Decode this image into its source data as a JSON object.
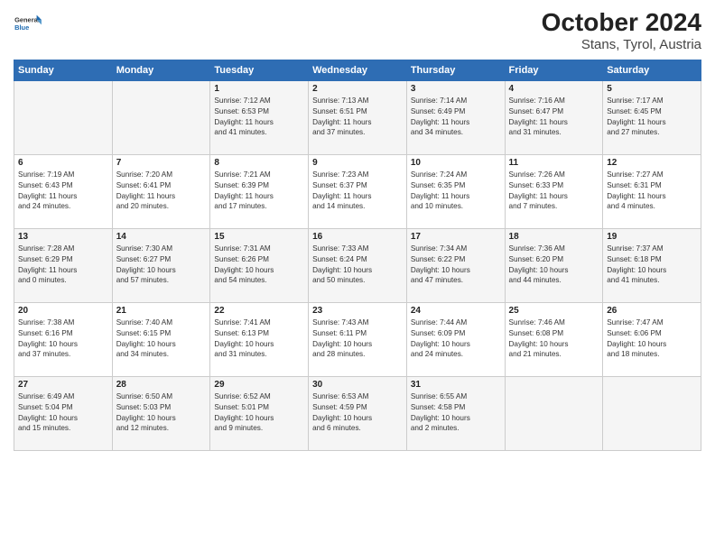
{
  "header": {
    "logo_general": "General",
    "logo_blue": "Blue",
    "month_title": "October 2024",
    "location": "Stans, Tyrol, Austria"
  },
  "weekdays": [
    "Sunday",
    "Monday",
    "Tuesday",
    "Wednesday",
    "Thursday",
    "Friday",
    "Saturday"
  ],
  "weeks": [
    [
      {
        "day": "",
        "info": ""
      },
      {
        "day": "",
        "info": ""
      },
      {
        "day": "1",
        "info": "Sunrise: 7:12 AM\nSunset: 6:53 PM\nDaylight: 11 hours\nand 41 minutes."
      },
      {
        "day": "2",
        "info": "Sunrise: 7:13 AM\nSunset: 6:51 PM\nDaylight: 11 hours\nand 37 minutes."
      },
      {
        "day": "3",
        "info": "Sunrise: 7:14 AM\nSunset: 6:49 PM\nDaylight: 11 hours\nand 34 minutes."
      },
      {
        "day": "4",
        "info": "Sunrise: 7:16 AM\nSunset: 6:47 PM\nDaylight: 11 hours\nand 31 minutes."
      },
      {
        "day": "5",
        "info": "Sunrise: 7:17 AM\nSunset: 6:45 PM\nDaylight: 11 hours\nand 27 minutes."
      }
    ],
    [
      {
        "day": "6",
        "info": "Sunrise: 7:19 AM\nSunset: 6:43 PM\nDaylight: 11 hours\nand 24 minutes."
      },
      {
        "day": "7",
        "info": "Sunrise: 7:20 AM\nSunset: 6:41 PM\nDaylight: 11 hours\nand 20 minutes."
      },
      {
        "day": "8",
        "info": "Sunrise: 7:21 AM\nSunset: 6:39 PM\nDaylight: 11 hours\nand 17 minutes."
      },
      {
        "day": "9",
        "info": "Sunrise: 7:23 AM\nSunset: 6:37 PM\nDaylight: 11 hours\nand 14 minutes."
      },
      {
        "day": "10",
        "info": "Sunrise: 7:24 AM\nSunset: 6:35 PM\nDaylight: 11 hours\nand 10 minutes."
      },
      {
        "day": "11",
        "info": "Sunrise: 7:26 AM\nSunset: 6:33 PM\nDaylight: 11 hours\nand 7 minutes."
      },
      {
        "day": "12",
        "info": "Sunrise: 7:27 AM\nSunset: 6:31 PM\nDaylight: 11 hours\nand 4 minutes."
      }
    ],
    [
      {
        "day": "13",
        "info": "Sunrise: 7:28 AM\nSunset: 6:29 PM\nDaylight: 11 hours\nand 0 minutes."
      },
      {
        "day": "14",
        "info": "Sunrise: 7:30 AM\nSunset: 6:27 PM\nDaylight: 10 hours\nand 57 minutes."
      },
      {
        "day": "15",
        "info": "Sunrise: 7:31 AM\nSunset: 6:26 PM\nDaylight: 10 hours\nand 54 minutes."
      },
      {
        "day": "16",
        "info": "Sunrise: 7:33 AM\nSunset: 6:24 PM\nDaylight: 10 hours\nand 50 minutes."
      },
      {
        "day": "17",
        "info": "Sunrise: 7:34 AM\nSunset: 6:22 PM\nDaylight: 10 hours\nand 47 minutes."
      },
      {
        "day": "18",
        "info": "Sunrise: 7:36 AM\nSunset: 6:20 PM\nDaylight: 10 hours\nand 44 minutes."
      },
      {
        "day": "19",
        "info": "Sunrise: 7:37 AM\nSunset: 6:18 PM\nDaylight: 10 hours\nand 41 minutes."
      }
    ],
    [
      {
        "day": "20",
        "info": "Sunrise: 7:38 AM\nSunset: 6:16 PM\nDaylight: 10 hours\nand 37 minutes."
      },
      {
        "day": "21",
        "info": "Sunrise: 7:40 AM\nSunset: 6:15 PM\nDaylight: 10 hours\nand 34 minutes."
      },
      {
        "day": "22",
        "info": "Sunrise: 7:41 AM\nSunset: 6:13 PM\nDaylight: 10 hours\nand 31 minutes."
      },
      {
        "day": "23",
        "info": "Sunrise: 7:43 AM\nSunset: 6:11 PM\nDaylight: 10 hours\nand 28 minutes."
      },
      {
        "day": "24",
        "info": "Sunrise: 7:44 AM\nSunset: 6:09 PM\nDaylight: 10 hours\nand 24 minutes."
      },
      {
        "day": "25",
        "info": "Sunrise: 7:46 AM\nSunset: 6:08 PM\nDaylight: 10 hours\nand 21 minutes."
      },
      {
        "day": "26",
        "info": "Sunrise: 7:47 AM\nSunset: 6:06 PM\nDaylight: 10 hours\nand 18 minutes."
      }
    ],
    [
      {
        "day": "27",
        "info": "Sunrise: 6:49 AM\nSunset: 5:04 PM\nDaylight: 10 hours\nand 15 minutes."
      },
      {
        "day": "28",
        "info": "Sunrise: 6:50 AM\nSunset: 5:03 PM\nDaylight: 10 hours\nand 12 minutes."
      },
      {
        "day": "29",
        "info": "Sunrise: 6:52 AM\nSunset: 5:01 PM\nDaylight: 10 hours\nand 9 minutes."
      },
      {
        "day": "30",
        "info": "Sunrise: 6:53 AM\nSunset: 4:59 PM\nDaylight: 10 hours\nand 6 minutes."
      },
      {
        "day": "31",
        "info": "Sunrise: 6:55 AM\nSunset: 4:58 PM\nDaylight: 10 hours\nand 2 minutes."
      },
      {
        "day": "",
        "info": ""
      },
      {
        "day": "",
        "info": ""
      }
    ]
  ]
}
